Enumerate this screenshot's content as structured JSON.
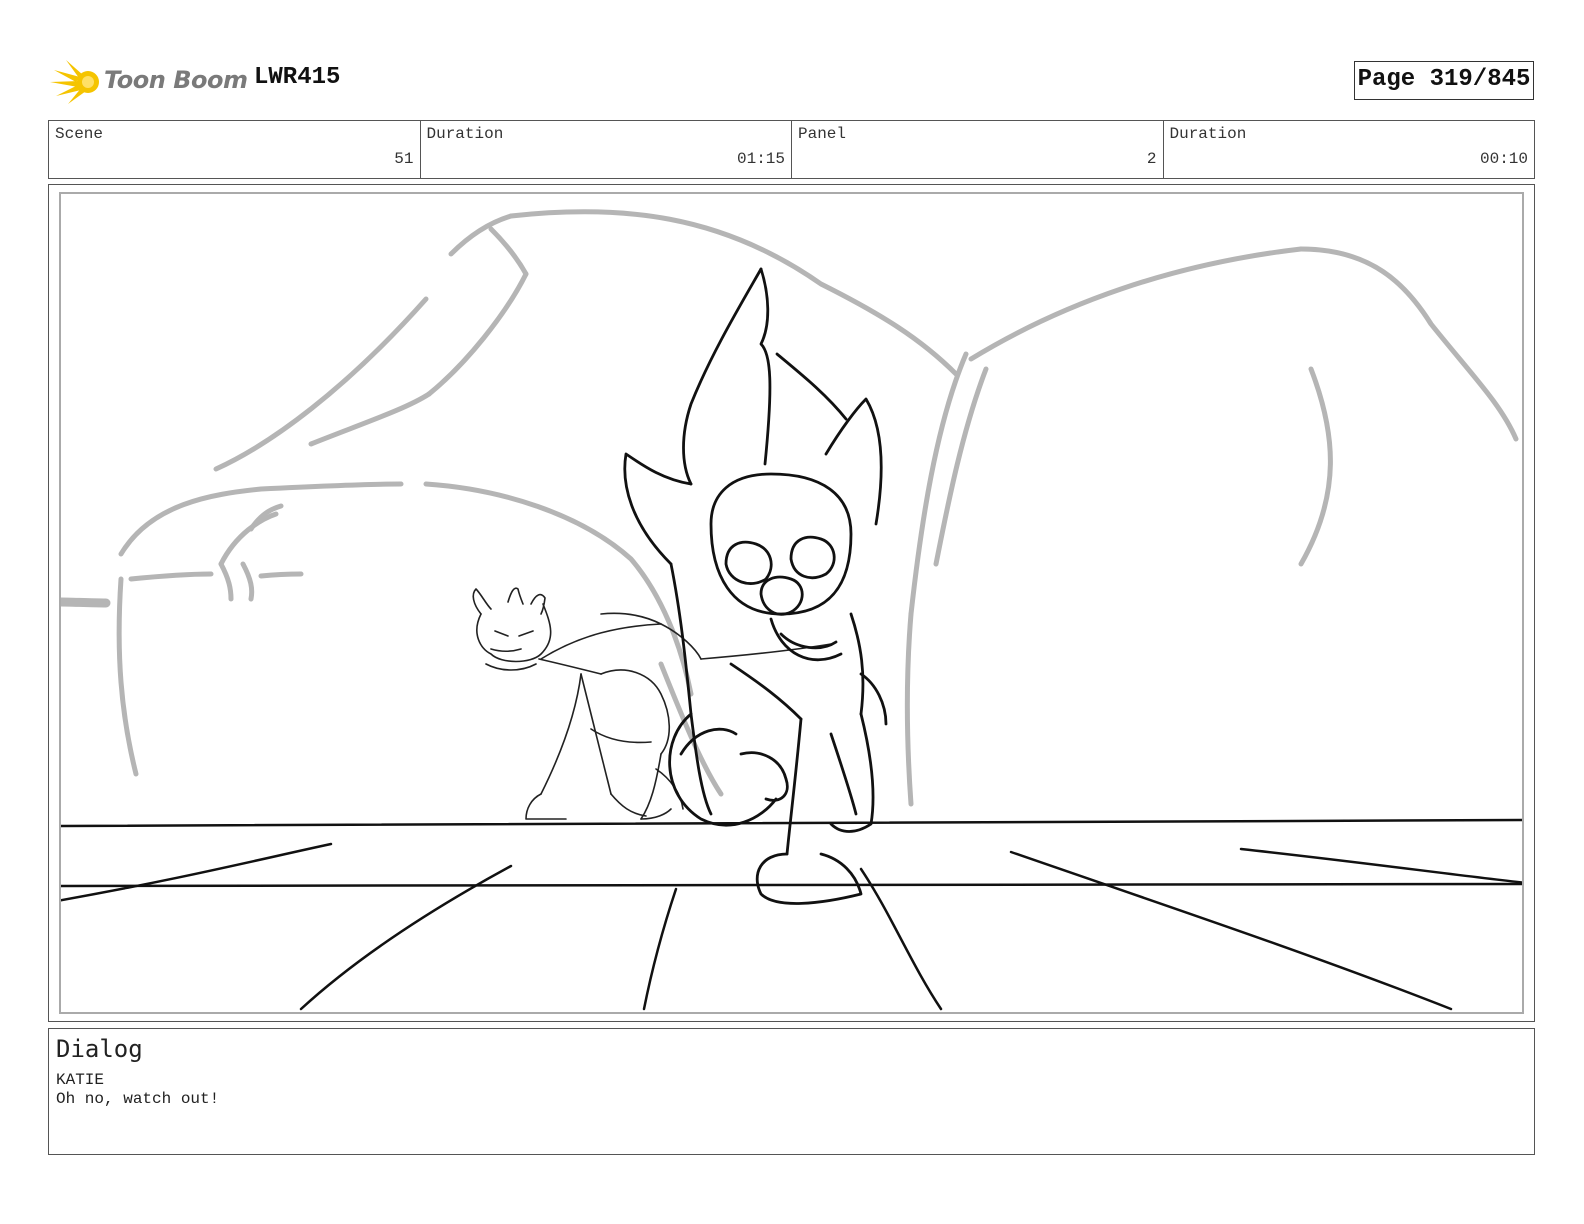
{
  "header": {
    "logo_text": "Toon Boom",
    "project_code": "LWR415",
    "page_indicator": "Page 319/845"
  },
  "info": {
    "scene_label": "Scene",
    "scene_value": "51",
    "scene_duration_label": "Duration",
    "scene_duration_value": "01:15",
    "panel_label": "Panel",
    "panel_value": "2",
    "panel_duration_label": "Duration",
    "panel_duration_value": "00:10"
  },
  "dialog": {
    "title": "Dialog",
    "speaker": "KATIE",
    "line": "Oh no, watch out!"
  },
  "colors": {
    "logo_yellow": "#f5c400",
    "logo_text": "#7a7a7a",
    "background_sketch": "#b5b5b5",
    "foreground_sketch": "#111111"
  }
}
